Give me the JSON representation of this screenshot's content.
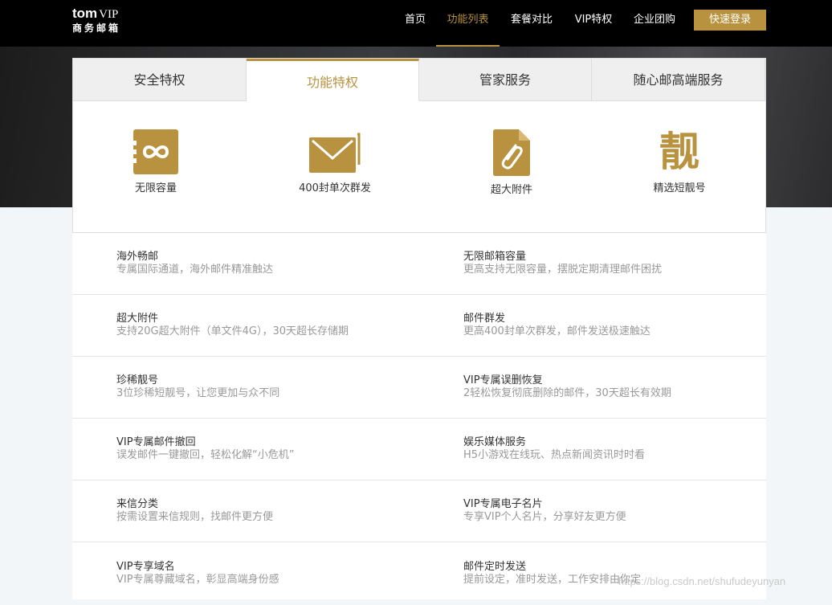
{
  "logo": {
    "brand": "tom",
    "vip": "VIP",
    "subtitle": "商务邮箱"
  },
  "nav": {
    "items": [
      "首页",
      "功能列表",
      "套餐对比",
      "VIP特权",
      "企业团购"
    ],
    "active_index": 1,
    "login_label": "快速登录"
  },
  "tabs": {
    "items": [
      "安全特权",
      "功能特权",
      "管家服务",
      "随心邮高端服务"
    ],
    "active_index": 1
  },
  "features": [
    {
      "label": "无限容量",
      "icon": "infinity-icon"
    },
    {
      "label": "400封单次群发",
      "icon": "envelope-icon"
    },
    {
      "label": "超大附件",
      "icon": "paperclip-file-icon"
    },
    {
      "label": "精选短靓号",
      "icon": "liang-char-icon",
      "glyph": "靓"
    }
  ],
  "rows": [
    {
      "left": {
        "title": "海外畅邮",
        "desc": "专属国际通道，海外邮件精准触达"
      },
      "right": {
        "title": "无限邮箱容量",
        "desc": "更高支持无限容量，摆脱定期清理邮件困扰"
      }
    },
    {
      "left": {
        "title": "超大附件",
        "desc": "支持20G超大附件（单文件4G），30天超长存储期"
      },
      "right": {
        "title": "邮件群发",
        "desc": "更高400封单次群发，邮件发送极速触达"
      }
    },
    {
      "left": {
        "title": "珍稀靓号",
        "desc": "3位珍稀短靓号，让您更加与众不同"
      },
      "right": {
        "title": "VIP专属误删恢复",
        "desc": "2轻松恢复彻底删除的邮件，30天超长有效期"
      }
    },
    {
      "left": {
        "title": "VIP专属邮件撤回",
        "desc": "误发邮件一键撤回，轻松化解“小危机”"
      },
      "right": {
        "title": "娱乐媒体服务",
        "desc": "H5小游戏在线玩、热点新闻资讯时时看"
      }
    },
    {
      "left": {
        "title": "来信分类",
        "desc": "按需设置来信规则，找邮件更方便"
      },
      "right": {
        "title": "VIP专属电子名片",
        "desc": "专享VIP个人名片，分享好友更方便"
      }
    },
    {
      "left": {
        "title": "VIP专享域名",
        "desc": "VIP专属尊藏域名，彰显高端身份感"
      },
      "right": {
        "title": "邮件定时发送",
        "desc": "提前设定，准时发送，工作安排由你定"
      }
    }
  ],
  "watermark": "https://blog.csdn.net/shufudeyunyan",
  "colors": {
    "accent": "#b8923f",
    "header": "#000000"
  }
}
